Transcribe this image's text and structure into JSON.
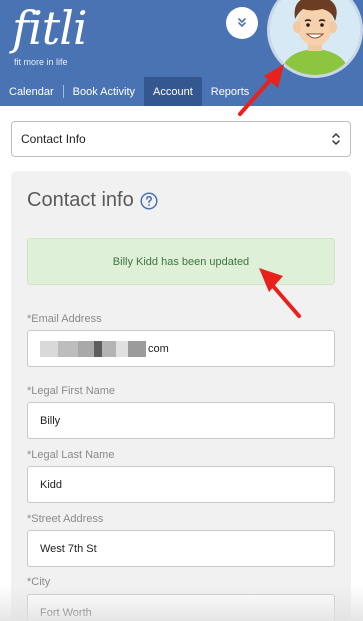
{
  "brand": {
    "logo_text": "fitli",
    "tagline": "fit more in life"
  },
  "nav": {
    "items": [
      {
        "label": "Calendar",
        "active": false
      },
      {
        "label": "Book Activity",
        "active": false
      },
      {
        "label": "Account",
        "active": true
      },
      {
        "label": "Reports",
        "active": false
      }
    ]
  },
  "section_select": {
    "selected": "Contact Info"
  },
  "card": {
    "title": "Contact info"
  },
  "alert": {
    "message": "Billy Kidd has been updated"
  },
  "form": {
    "email_label": "*Email Address",
    "email_value_visible": "com",
    "first_name_label": "*Legal First Name",
    "first_name_value": "Billy",
    "last_name_label": "*Legal Last Name",
    "last_name_value": "Kidd",
    "street_label": "*Street Address",
    "street_value": "West 7th St",
    "city_label": "*City",
    "city_value": "Fort Worth"
  },
  "colors": {
    "header_bg": "#4a73b3",
    "nav_active_bg": "#35578f",
    "alert_bg": "#dff0d8",
    "alert_text": "#3c763d",
    "annotation_arrow": "#e8211c"
  },
  "icons": {
    "expand": "double-chevron-down-icon",
    "help": "question-circle-icon",
    "select_caret": "up-down-caret-icon"
  }
}
